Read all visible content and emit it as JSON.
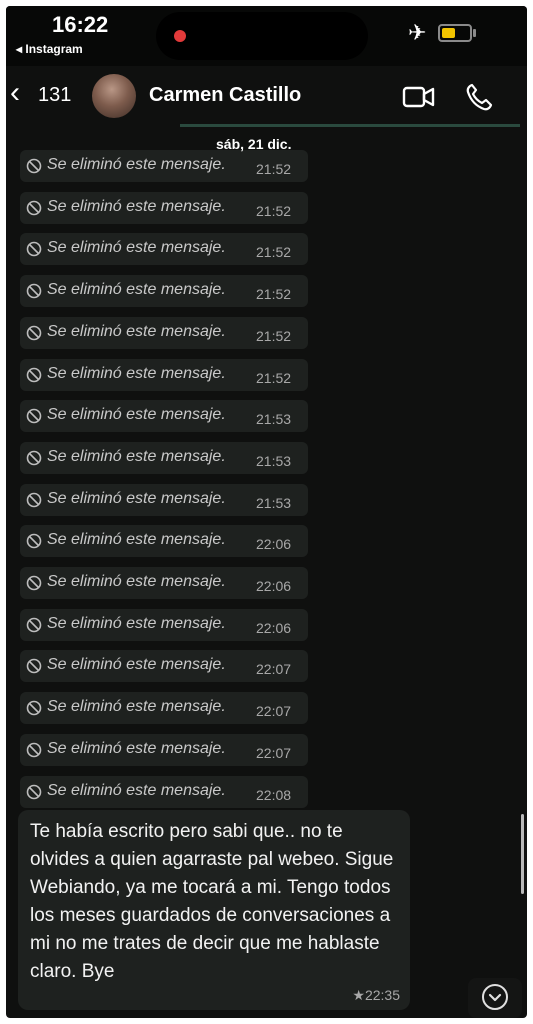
{
  "status_bar": {
    "time": "16:22",
    "back_app": "◂ Instagram",
    "battery_level": 0.6
  },
  "header": {
    "back_count": "131",
    "contact_name": "Carmen Castillo",
    "icons": [
      "video-call-icon",
      "voice-call-icon"
    ]
  },
  "date_chip": "sáb, 21 dic.",
  "deleted_messages": [
    {
      "text": "Se eliminó este mensaje.",
      "time": "21:52"
    },
    {
      "text": "Se eliminó este mensaje.",
      "time": "21:52"
    },
    {
      "text": "Se eliminó este mensaje.",
      "time": "21:52"
    },
    {
      "text": "Se eliminó este mensaje.",
      "time": "21:52"
    },
    {
      "text": "Se eliminó este mensaje.",
      "time": "21:52"
    },
    {
      "text": "Se eliminó este mensaje.",
      "time": "21:52"
    },
    {
      "text": "Se eliminó este mensaje.",
      "time": "21:53"
    },
    {
      "text": "Se eliminó este mensaje.",
      "time": "21:53"
    },
    {
      "text": "Se eliminó este mensaje.",
      "time": "21:53"
    },
    {
      "text": "Se eliminó este mensaje.",
      "time": "22:06"
    },
    {
      "text": "Se eliminó este mensaje.",
      "time": "22:06"
    },
    {
      "text": "Se eliminó este mensaje.",
      "time": "22:06"
    },
    {
      "text": "Se eliminó este mensaje.",
      "time": "22:07"
    },
    {
      "text": "Se eliminó este mensaje.",
      "time": "22:07"
    },
    {
      "text": "Se eliminó este mensaje.",
      "time": "22:07"
    },
    {
      "text": "Se eliminó este mensaje.",
      "time": "22:08"
    }
  ],
  "last_message": {
    "text": "Te había escrito pero sabi que.. no te olvides a quien agarraste pal webeo. Sigue Webiando, ya me tocará a mi. Tengo  todos los meses guardados de conversaciones a mi no me trates de decir que me hablaste claro. Bye",
    "starred": "★",
    "time": "22:35"
  },
  "colors": {
    "background": "#0f100f",
    "bubble": "#1e211f",
    "accent_line": "#2a4a3e",
    "battery": "#f2c400",
    "recording_dot": "#e23a3a"
  },
  "scroll_down_icon": "chevron-down-icon"
}
